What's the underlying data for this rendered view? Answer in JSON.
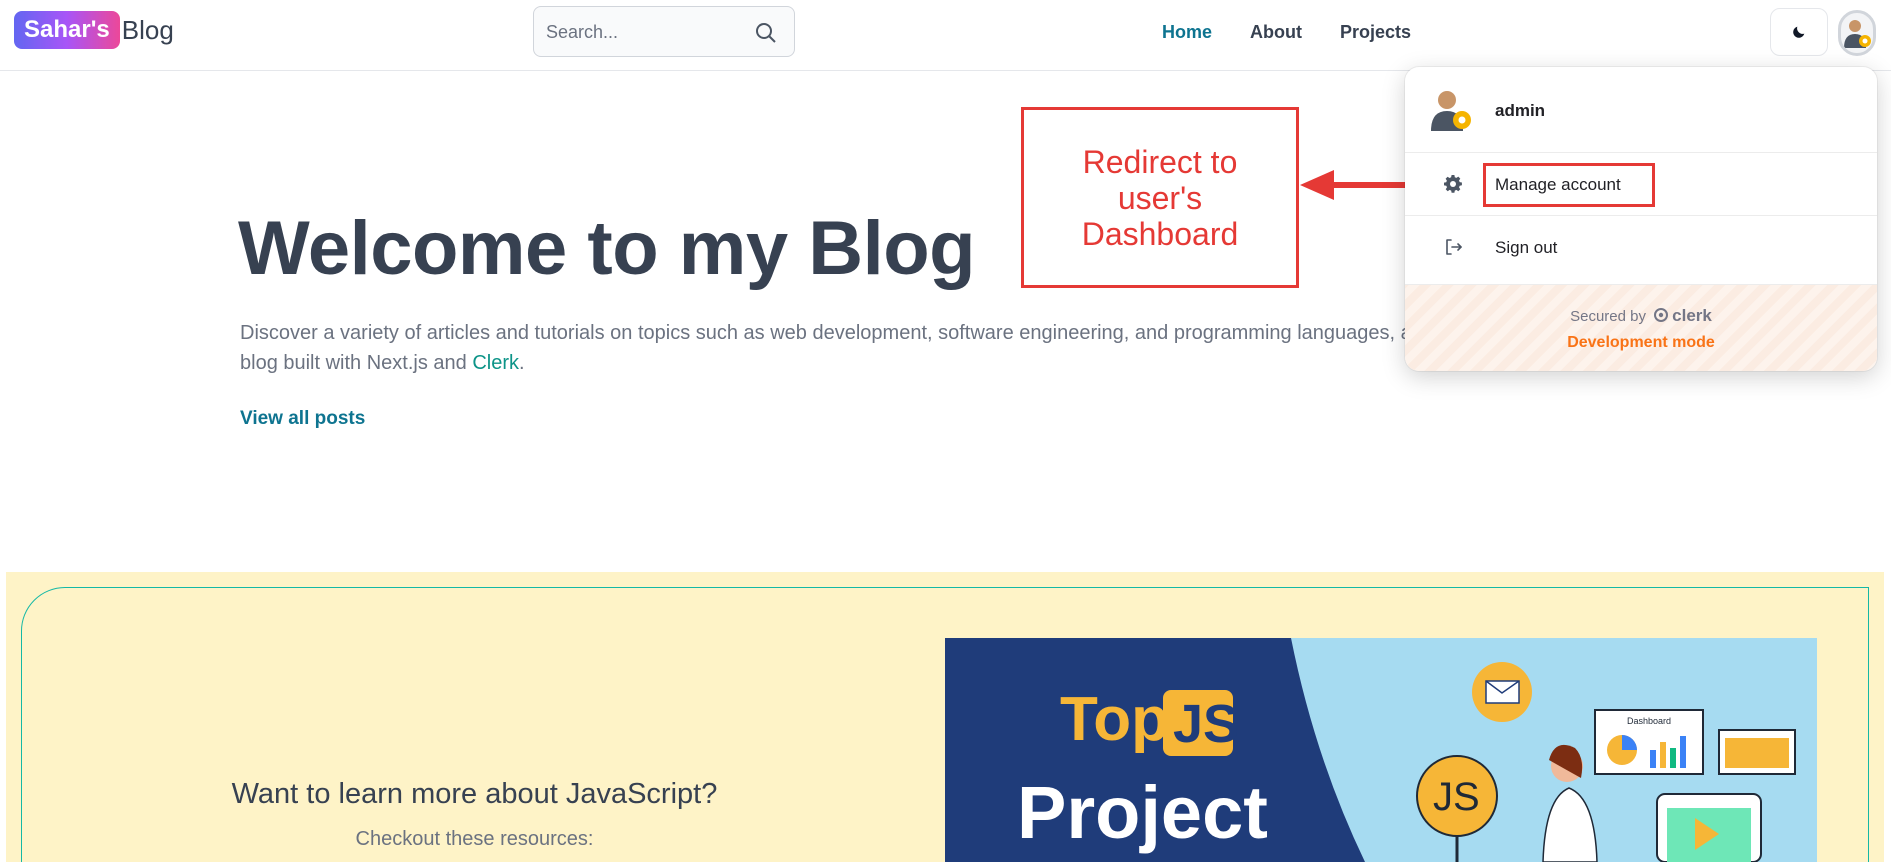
{
  "header": {
    "logo_badge": "Sahar's",
    "logo_text": "Blog",
    "search_placeholder": "Search...",
    "nav": [
      {
        "label": "Home",
        "active": true
      },
      {
        "label": "About",
        "active": false
      },
      {
        "label": "Projects",
        "active": false
      }
    ]
  },
  "hero": {
    "title": "Welcome to my Blog",
    "description_part1": "Discover a variety of articles and tutorials on topics such as web development, software engineering, and programming languages, a",
    "description_part2": "blog built with Next.js and ",
    "clerk_link": "Clerk",
    "description_end": ".",
    "view_all": "View all posts"
  },
  "annotation": {
    "text_line1": "Redirect to",
    "text_line2": "user's",
    "text_line3": "Dashboard",
    "color": "#e53935"
  },
  "dropdown": {
    "username": "admin",
    "manage_account": "Manage account",
    "sign_out": "Sign out",
    "secured_by": "Secured by",
    "clerk_brand": "clerk",
    "dev_mode": "Development mode"
  },
  "promo": {
    "title": "Want to learn more about JavaScript?",
    "subtitle": "Checkout these resources:",
    "image": {
      "top": "Top",
      "js": "JS",
      "project": "Project",
      "dashboard_label": "Dashboard"
    }
  },
  "colors": {
    "accent": "#0e7490",
    "promo_bg": "#fef3c7",
    "dev_mode": "#f97316"
  }
}
